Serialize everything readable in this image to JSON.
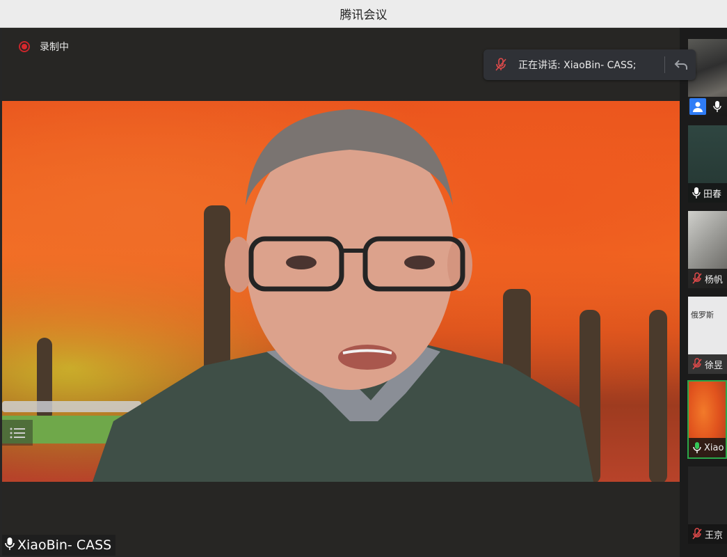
{
  "window": {
    "title": "腾讯会议"
  },
  "recording": {
    "label": "录制中"
  },
  "speaking": {
    "text": "正在讲话: XiaoBin- CASS;"
  },
  "main_video": {
    "name": "XiaoBin- CASS"
  },
  "participants": [
    {
      "name": "",
      "mic": "on",
      "avatar": "person-icon"
    },
    {
      "name": "田春",
      "mic": "on"
    },
    {
      "name": "杨帆",
      "mic": "muted"
    },
    {
      "name": "徐昱",
      "mic": "muted",
      "screen_text": "俄罗斯"
    },
    {
      "name": "Xiao",
      "mic": "active"
    },
    {
      "name": "王京",
      "mic": "muted"
    }
  ],
  "colors": {
    "recording": "#d6292e",
    "active_border": "#2ba84a",
    "muted": "#e04a4a",
    "active_mic": "#35c759",
    "avatar": "#2f7cf6"
  }
}
